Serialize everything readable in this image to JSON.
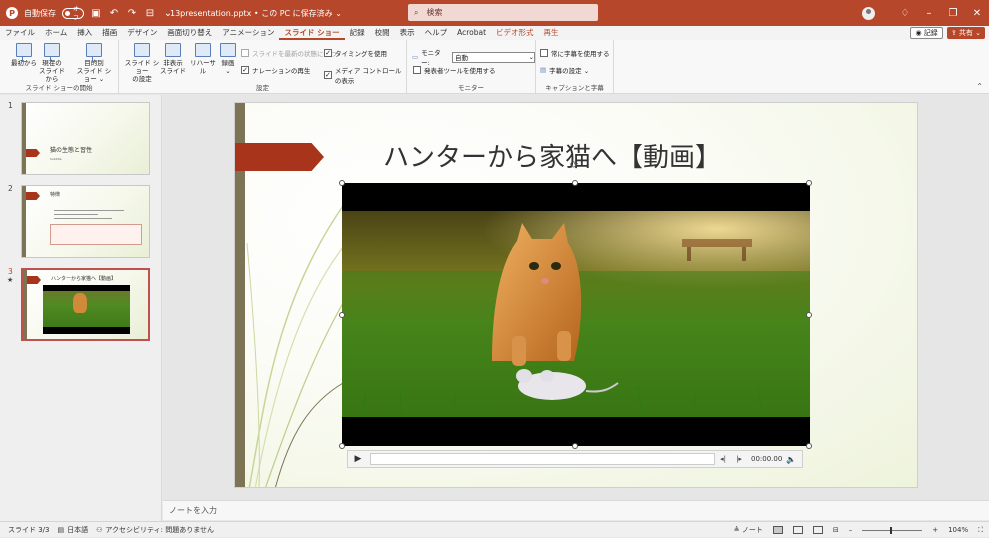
{
  "titlebar": {
    "autosave_label": "自動保存",
    "autosave_state": "オフ",
    "filename": "13presentation.pptx • この PC に保存済み ⌄",
    "search_placeholder": "検索"
  },
  "tabs": [
    {
      "label": "ファイル"
    },
    {
      "label": "ホーム"
    },
    {
      "label": "挿入"
    },
    {
      "label": "描画"
    },
    {
      "label": "デザイン"
    },
    {
      "label": "画面切り替え"
    },
    {
      "label": "アニメーション"
    },
    {
      "label": "スライド ショー"
    },
    {
      "label": "記録"
    },
    {
      "label": "校閲"
    },
    {
      "label": "表示"
    },
    {
      "label": "ヘルプ"
    },
    {
      "label": "Acrobat"
    },
    {
      "label": "ビデオ形式"
    },
    {
      "label": "再生"
    }
  ],
  "tabs_right": {
    "record": "記録",
    "share": "共有"
  },
  "ribbon": {
    "start_group": {
      "label": "スライド ショーの開始",
      "from_beginning": "最初から",
      "from_current_1": "現在の",
      "from_current_2": "スライドから",
      "custom_1": "目的別",
      "custom_2": "スライド ショー ⌄"
    },
    "setup_group": {
      "label": "設定",
      "setup_1": "スライド ショー",
      "setup_2": "の設定",
      "hide_1": "非表示",
      "hide_2": "スライド",
      "rehearse": "リハーサル",
      "record_1": "録画",
      "record_2": "⌄",
      "keep_fresh": "スライドを最新の状態に保つ",
      "narration": "ナレーションの再生",
      "timings": "タイミングを使用",
      "media_controls": "メディア コントロールの表示"
    },
    "monitor_group": {
      "label": "モニター",
      "monitor_label": "モニター:",
      "monitor_value": "自動",
      "presenter_view": "発表者ツールを使用する"
    },
    "captions_group": {
      "label": "キャプションと字幕",
      "always_subtitles": "常に字幕を使用する",
      "subtitle_settings": "字幕の設定 ⌄"
    }
  },
  "slides_panel": {
    "thumbs": [
      {
        "num": "1",
        "title": "猫の生態と習性",
        "subtitle": "Subtitle"
      },
      {
        "num": "2",
        "title": "特徴"
      },
      {
        "num": "3",
        "title": "ハンターから家猫へ【動画】",
        "star": "★"
      }
    ]
  },
  "slide": {
    "title": "ハンターから家猫へ【動画】"
  },
  "video_controls": {
    "time": "00:00.00"
  },
  "notes": {
    "placeholder": "ノートを入力"
  },
  "statusbar": {
    "slide_count": "スライド 3/3",
    "language": "日本語",
    "accessibility": "アクセシビリティ: 問題ありません",
    "notes_btn": "ノート",
    "zoom": "104%"
  },
  "colors": {
    "brand": "#b7472a",
    "slide_accent": "#a8341c",
    "slide_stripe": "#7d7355"
  }
}
